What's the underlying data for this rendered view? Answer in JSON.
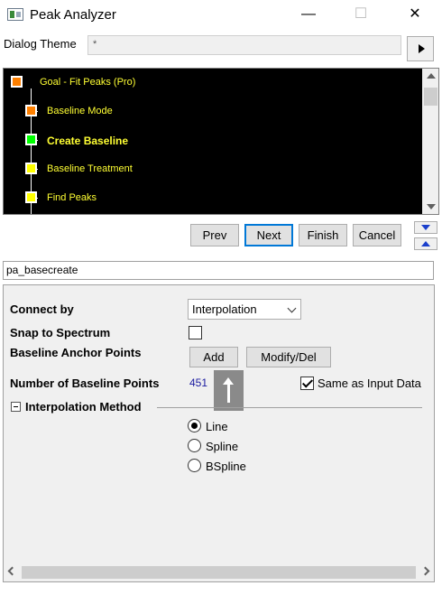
{
  "window": {
    "title": "Peak Analyzer",
    "minimize": "—",
    "maximize": "☐",
    "close": "✕"
  },
  "theme": {
    "label": "Dialog Theme",
    "value": "*"
  },
  "tree": {
    "items": [
      {
        "label": "Goal - Fit Peaks (Pro)",
        "color": "#ff8000"
      },
      {
        "label": "Baseline Mode",
        "color": "#ff8000"
      },
      {
        "label": "Create Baseline",
        "color": "#00ff00"
      },
      {
        "label": "Baseline Treatment",
        "color": "#ffff00"
      },
      {
        "label": "Find Peaks",
        "color": "#ffff00"
      }
    ]
  },
  "nav": {
    "prev": "Prev",
    "next": "Next",
    "finish": "Finish",
    "cancel": "Cancel"
  },
  "page_name": "pa_basecreate",
  "settings": {
    "connect_by_label": "Connect by",
    "connect_by_value": "Interpolation",
    "snap_label": "Snap to Spectrum",
    "anchor_label": "Baseline Anchor Points",
    "add_button": "Add",
    "modify_button": "Modify/Del",
    "num_points_label": "Number of Baseline Points",
    "num_points_value": "451",
    "same_as_input_label": "Same as Input Data",
    "same_as_input_checked": true,
    "snap_checked": false
  },
  "interpolation": {
    "label": "Interpolation Method",
    "options": [
      "Line",
      "Spline",
      "BSpline"
    ],
    "selected": "Line"
  }
}
